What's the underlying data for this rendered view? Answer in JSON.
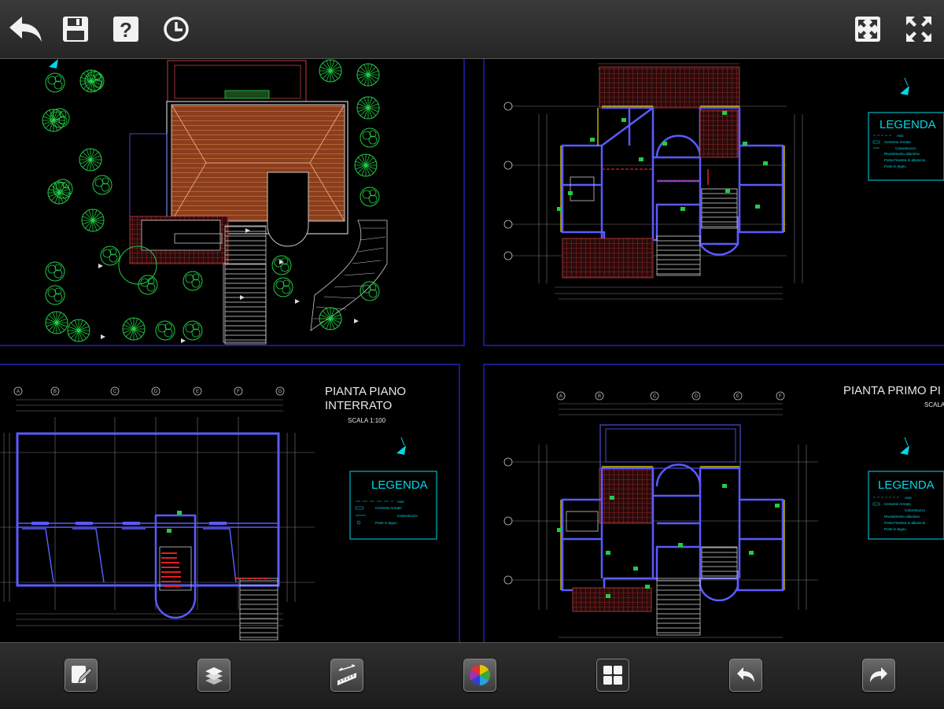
{
  "toolbar": {
    "back_icon": "back-arrow-icon",
    "save_icon": "floppy-disk-icon",
    "help_icon": "question-mark-icon",
    "history_icon": "clock-icon",
    "fit_icon": "zoom-extents-icon",
    "fullscreen_icon": "fullscreen-arrows-icon"
  },
  "bottom_toolbar": {
    "items": [
      "edit-markup-icon",
      "layers-icon",
      "measure-ruler-icon",
      "color-wheel-icon",
      "layout-tiles-icon",
      "undo-icon",
      "redo-icon"
    ]
  },
  "drawing": {
    "sheet_bl": {
      "title_line1": "PIANTA PIANO",
      "title_line2": "INTERRATO",
      "scale": "SCALA 1:100",
      "legend_title": "LEGENDA",
      "legend_items": [
        "Assi",
        "Cemento Armato",
        "Calcestruzzo",
        "Porte in legno"
      ],
      "grid_labels": [
        "A",
        "B",
        "C",
        "D",
        "E",
        "F",
        "G"
      ]
    },
    "sheet_br": {
      "title_line1": "PIANTA PRIMO PI",
      "scale": "SCALA",
      "legend_title": "LEGENDA",
      "legend_items": [
        "Assi",
        "Cemento Armato",
        "Calcestruzzo",
        "Rivestimento alluminio",
        "Porta-Finestra in alluminio",
        "Porte in legno"
      ],
      "grid_labels": [
        "A",
        "B",
        "C",
        "D",
        "E",
        "F"
      ]
    },
    "sheet_tr": {
      "legend_title": "LEGENDA",
      "legend_items": [
        "Assi",
        "Cemento Armato",
        "Calcestruzzo",
        "Rivestimento alluminio",
        "Porta-Finestra in alluminio",
        "Porte in legno"
      ]
    },
    "colors": {
      "wall": "#5a5aff",
      "roof": "#b0562a",
      "tree": "#22cc44",
      "frame": "#2020c0",
      "legend": "#00d8e8",
      "red": "#e02020"
    }
  }
}
